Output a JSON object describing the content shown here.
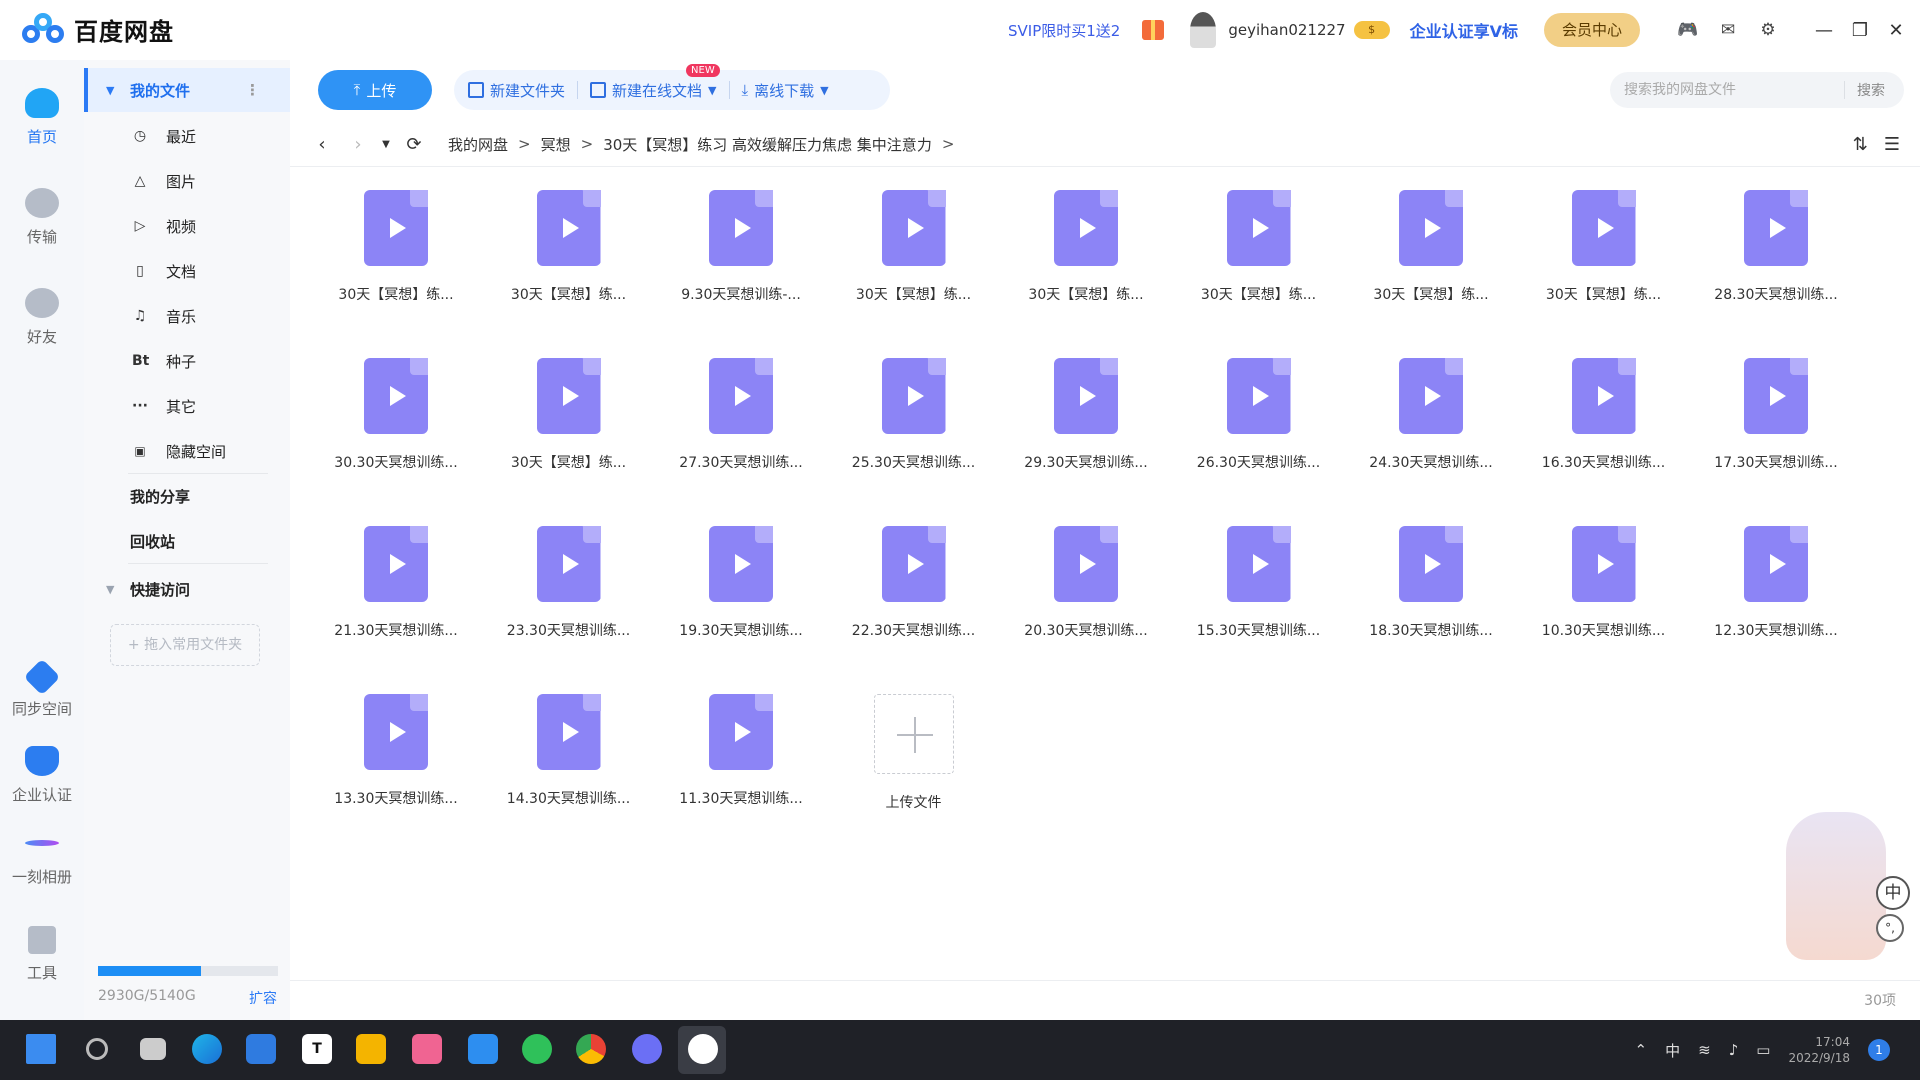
{
  "app": {
    "title": "百度网盘"
  },
  "header": {
    "promo": "SVIP限时买1送2",
    "username": "geyihan021227",
    "enterprise_link": "企业认证享V标",
    "member_center": "会员中心"
  },
  "rail": {
    "items": [
      {
        "label": "首页",
        "icon": "home-cloud-icon"
      },
      {
        "label": "传输",
        "icon": "transfer-icon"
      },
      {
        "label": "好友",
        "icon": "friends-icon"
      },
      {
        "label": "同步空间",
        "icon": "sync-space-icon"
      },
      {
        "label": "企业认证",
        "icon": "enterprise-cert-icon"
      },
      {
        "label": "一刻相册",
        "icon": "album-icon"
      },
      {
        "label": "工具",
        "icon": "tools-icon"
      }
    ]
  },
  "sidebar": {
    "my_files": "我的文件",
    "categories": [
      {
        "label": "最近",
        "glyph": "◷"
      },
      {
        "label": "图片",
        "glyph": "△"
      },
      {
        "label": "视频",
        "glyph": "▷"
      },
      {
        "label": "文档",
        "glyph": "▯"
      },
      {
        "label": "音乐",
        "glyph": "♫"
      },
      {
        "label": "种子",
        "glyph": "Bt"
      },
      {
        "label": "其它",
        "glyph": "···"
      },
      {
        "label": "隐藏空间",
        "glyph": "🔒"
      }
    ],
    "my_share": "我的分享",
    "recycle": "回收站",
    "quick_access": "快捷访问",
    "drop_hint": "+ 拖入常用文件夹",
    "storage_text": "2930G/5140G",
    "storage_used_fraction": 0.57,
    "expand": "扩容"
  },
  "toolbar": {
    "upload": "上传",
    "new_folder": "新建文件夹",
    "new_online_doc": "新建在线文档",
    "new_badge": "NEW",
    "offline_download": "离线下载"
  },
  "search": {
    "placeholder": "搜索我的网盘文件",
    "button": "搜索"
  },
  "breadcrumb": [
    "我的网盘",
    "冥想",
    "30天【冥想】练习 高效缓解压力焦虑 集中注意力"
  ],
  "files": [
    "30天【冥想】练...",
    "30天【冥想】练...",
    "9.30天冥想训练-...",
    "30天【冥想】练...",
    "30天【冥想】练...",
    "30天【冥想】练...",
    "30天【冥想】练...",
    "30天【冥想】练...",
    "28.30天冥想训练...",
    "30.30天冥想训练...",
    "30天【冥想】练...",
    "27.30天冥想训练...",
    "25.30天冥想训练...",
    "29.30天冥想训练...",
    "26.30天冥想训练...",
    "24.30天冥想训练...",
    "16.30天冥想训练...",
    "17.30天冥想训练...",
    "21.30天冥想训练...",
    "23.30天冥想训练...",
    "19.30天冥想训练...",
    "22.30天冥想训练...",
    "20.30天冥想训练...",
    "15.30天冥想训练...",
    "18.30天冥想训练...",
    "10.30天冥想训练...",
    "12.30天冥想训练...",
    "13.30天冥想训练...",
    "14.30天冥想训练...",
    "11.30天冥想训练..."
  ],
  "upload_tile": "上传文件",
  "item_count": "30项",
  "ime": {
    "main": "中",
    "tray": "中"
  },
  "clock": {
    "time": "17:04",
    "date": "2022/9/18"
  },
  "notifications": "1",
  "colors": {
    "accent": "#2f93f5",
    "video_icon": "#8c84f6",
    "taskbar": "#1f2127"
  }
}
